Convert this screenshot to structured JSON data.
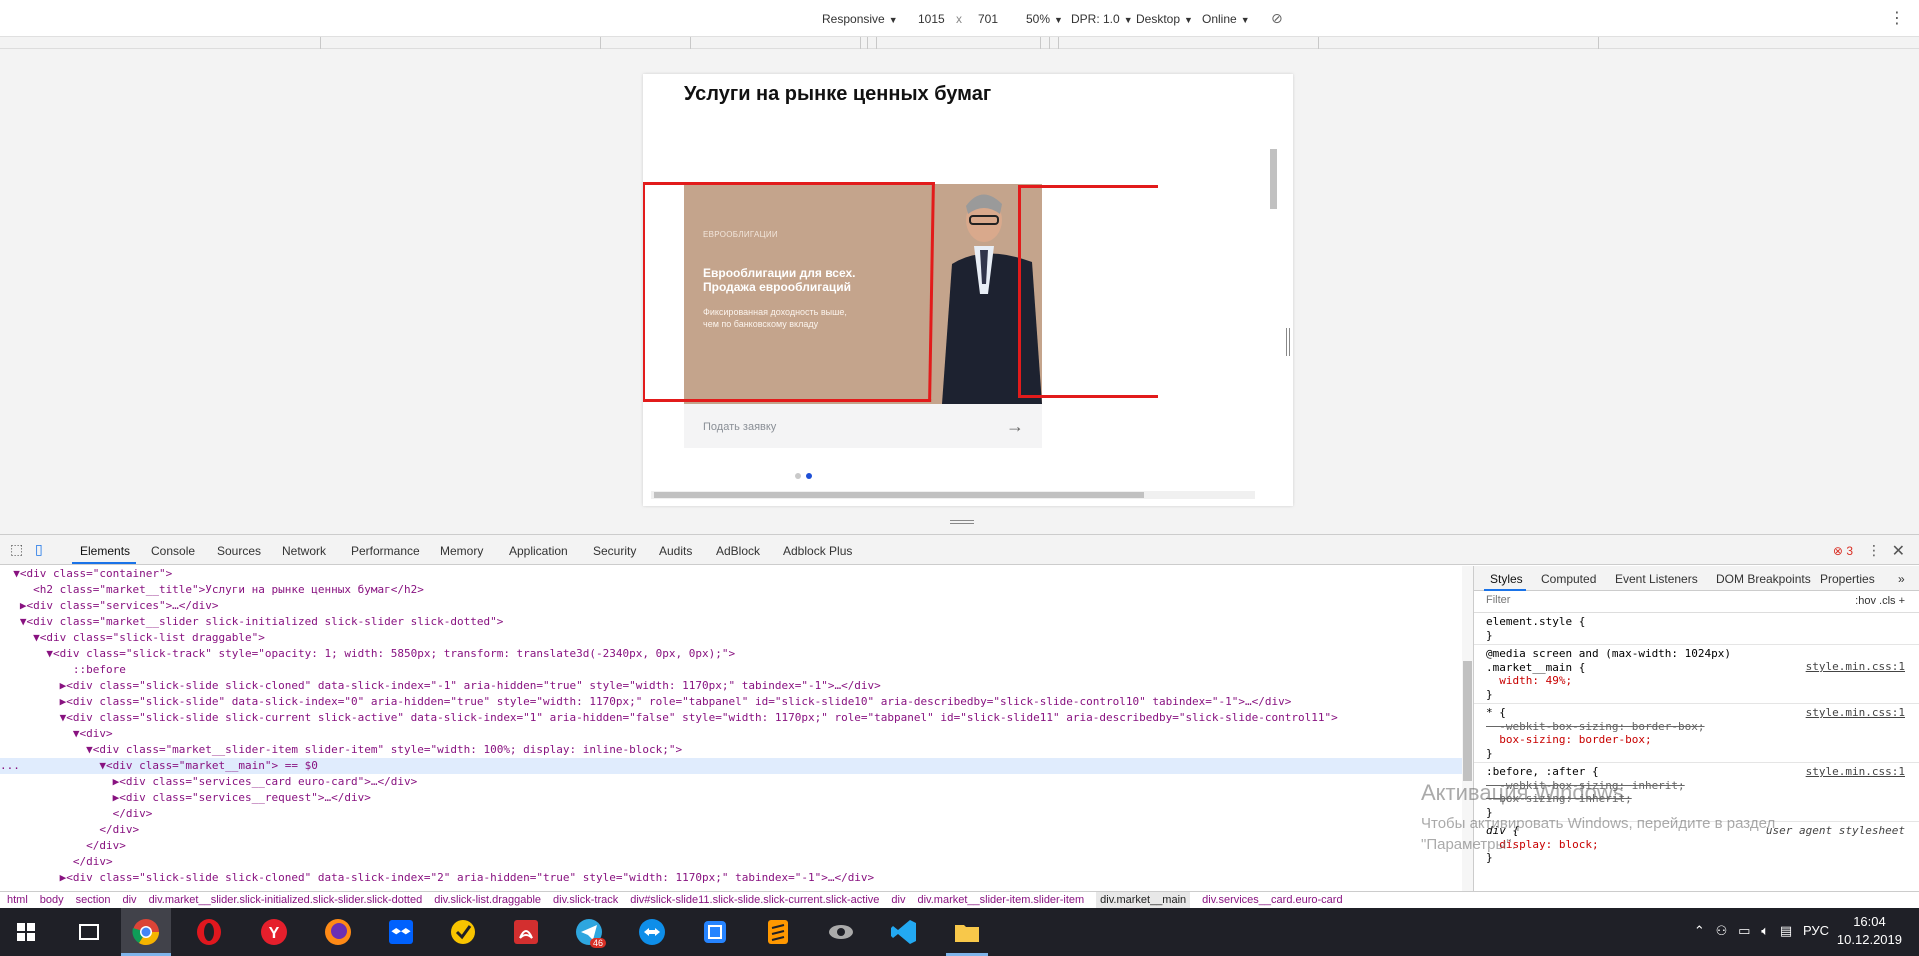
{
  "device_toolbar": {
    "device": "Responsive",
    "width": "1015",
    "times": "x",
    "height": "701",
    "zoom": "50%",
    "dpr": "DPR: 1.0",
    "mode": "Desktop",
    "network": "Online"
  },
  "page": {
    "title": "Услуги на рынке ценных бумаг",
    "card_tag": "ЕВРООБЛИГАЦИИ",
    "card_title": "Еврооблигации для всех.\nПродажа еврооблигаций",
    "card_desc": "Фиксированная доходность выше,\nчем по банковскому вкладу",
    "request_label": "Подать заявку",
    "arrow": "→",
    "slider_dots": 2,
    "active_dot": 1,
    "colors": {
      "card_bg": "#c4a48c",
      "annotation": "#e21b1b",
      "dot_active": "#1e4fd6"
    }
  },
  "devtools": {
    "tabs": [
      "Elements",
      "Console",
      "Sources",
      "Network",
      "Performance",
      "Memory",
      "Application",
      "Security",
      "Audits",
      "AdBlock",
      "Adblock Plus"
    ],
    "error_count": "3",
    "elements_lines": [
      "  ▼<div class=\"container\">",
      "     <h2 class=\"market__title\">Услуги на рынке ценных бумаг</h2>",
      "   ▶<div class=\"services\">…</div>",
      "   ▼<div class=\"market__slider slick-initialized slick-slider slick-dotted\">",
      "     ▼<div class=\"slick-list draggable\">",
      "       ▼<div class=\"slick-track\" style=\"opacity: 1; width: 5850px; transform: translate3d(-2340px, 0px, 0px);\">",
      "           ::before",
      "         ▶<div class=\"slick-slide slick-cloned\" data-slick-index=\"-1\" aria-hidden=\"true\" style=\"width: 1170px;\" tabindex=\"-1\">…</div>",
      "         ▶<div class=\"slick-slide\" data-slick-index=\"0\" aria-hidden=\"true\" style=\"width: 1170px;\" role=\"tabpanel\" id=\"slick-slide10\" aria-describedby=\"slick-slide-control10\" tabindex=\"-1\">…</div>",
      "         ▼<div class=\"slick-slide slick-current slick-active\" data-slick-index=\"1\" aria-hidden=\"false\" style=\"width: 1170px;\" role=\"tabpanel\" id=\"slick-slide11\" aria-describedby=\"slick-slide-control11\">",
      "           ▼<div>",
      "             ▼<div class=\"market__slider-item slider-item\" style=\"width: 100%; display: inline-block;\">",
      "...            ▼<div class=\"market__main\"> == $0",
      "                 ▶<div class=\"services__card euro-card\">…</div>",
      "                 ▶<div class=\"services__request\">…</div>",
      "                 </div>",
      "               </div>",
      "             </div>",
      "           </div>",
      "         ▶<div class=\"slick-slide slick-cloned\" data-slick-index=\"2\" aria-hidden=\"true\" style=\"width: 1170px;\" tabindex=\"-1\">…</div>"
    ],
    "styles_tabs": [
      "Styles",
      "Computed",
      "Event Listeners",
      "DOM Breakpoints",
      "Properties",
      "»"
    ],
    "filter_placeholder": "Filter",
    "filter_tools": ":hov  .cls  +",
    "rules": {
      "r1": "element.style {\n}",
      "r2_head": "@media screen and (max-width: 1024px)\n.market__main {",
      "r2_src": "style.min.css:1",
      "r2_prop": "  width: 49%;",
      "r3_head": "* {",
      "r3_src": "style.min.css:1",
      "r3_struck": "  -webkit-box-sizing: border-box;",
      "r3_prop": "  box-sizing: border-box;",
      "r4_head": ":before, :after {",
      "r4_src": "style.min.css:1",
      "r4_struck1": "  -webkit-box-sizing: inherit;",
      "r4_struck2": "  box-sizing: inherit;",
      "r5_head": "div {",
      "r5_src": "user agent stylesheet",
      "r5_prop": "  display: block;"
    },
    "watermark_title": "Активация Windows",
    "watermark_text": "Чтобы активировать Windows, перейдите в раздел\n\"Параметры\".",
    "breadcrumbs": [
      "html",
      "body",
      "section",
      "div",
      "div.market__slider.slick-initialized.slick-slider.slick-dotted",
      "div.slick-list.draggable",
      "div.slick-track",
      "div#slick-slide11.slick-slide.slick-current.slick-active",
      "div",
      "div.market__slider-item.slider-item",
      "div.market__main",
      "div.services__card.euro-card"
    ]
  },
  "taskbar": {
    "language": "РУС",
    "time": "16:04",
    "date": "10.12.2019",
    "telegram_badge": "46"
  }
}
